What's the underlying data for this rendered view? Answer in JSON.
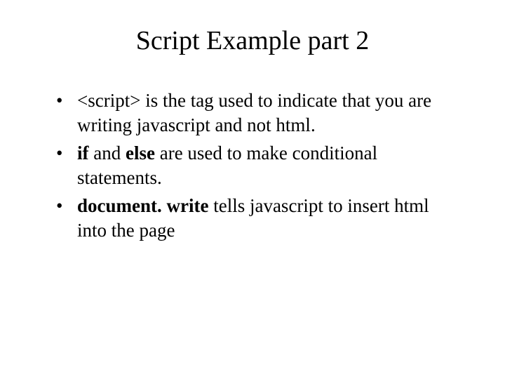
{
  "title": "Script Example part 2",
  "bullets": {
    "b1": {
      "k": "<script>",
      "rest": " is the tag used to indicate that you are writing javascript and not html."
    },
    "b2": {
      "k1": "if",
      "mid": " and ",
      "k2": "else",
      "rest": " are used to make conditional statements."
    },
    "b3": {
      "k": "document. write",
      "rest": " tells javascript to insert html into the page"
    }
  }
}
